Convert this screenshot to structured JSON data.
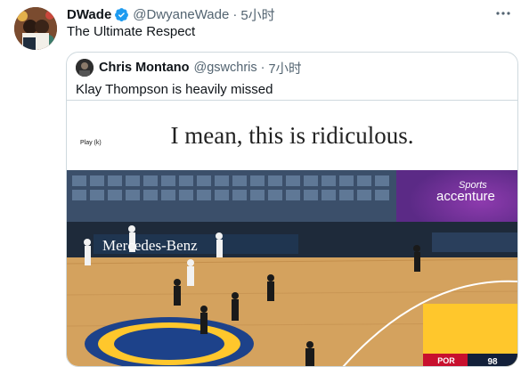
{
  "tweet": {
    "author_name": "DWade",
    "handle": "@DwyaneWade",
    "separator": "·",
    "time": "5小时",
    "text": "The Ultimate Respect"
  },
  "quoted": {
    "author_name": "Chris Montano",
    "handle": "@gswchris",
    "separator": "·",
    "time": "7小时",
    "text": "Klay Thompson is heavily missed",
    "caption": "I mean, this is ridiculous."
  },
  "video": {
    "play_label": "Play (k)",
    "banner_logo": "Mercedes-Benz",
    "sponsor": "accenture",
    "network": "Sports",
    "score_team": "POR",
    "score_value": "98"
  },
  "colors": {
    "verified": "#1d9bf0",
    "court_wood": "#d4a25e",
    "warriors_blue": "#1d428a",
    "warriors_gold": "#ffc72c"
  }
}
